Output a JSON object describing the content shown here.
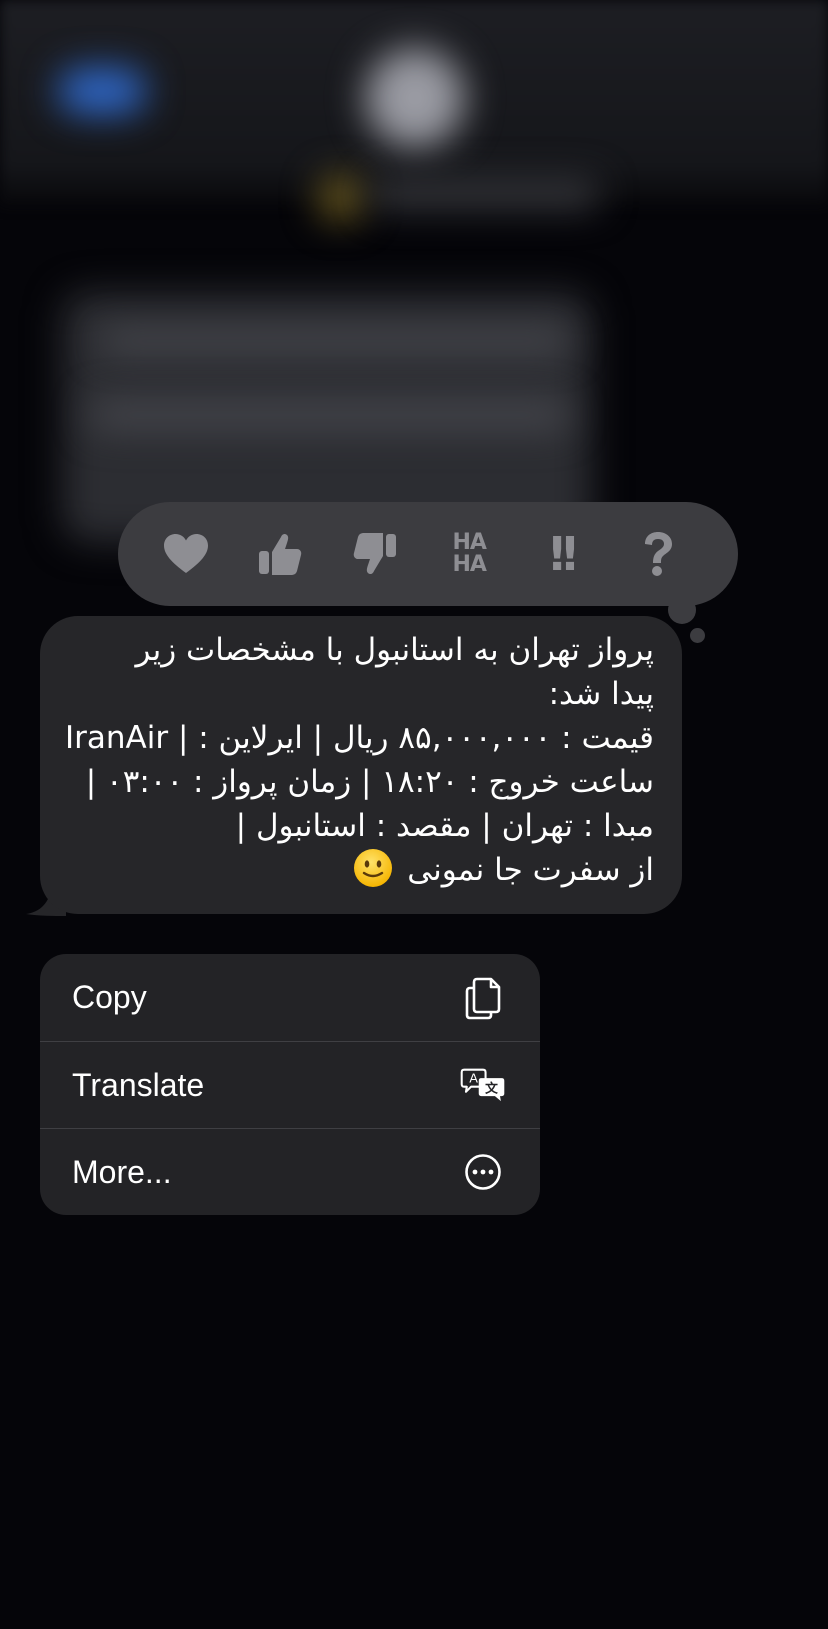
{
  "reactions": {
    "items": [
      "heart",
      "thumbs-up",
      "thumbs-down",
      "haha",
      "exclamation",
      "question"
    ],
    "haha_top": "HA",
    "haha_bottom": "HA",
    "emphasize_text": "!!",
    "question_text": "?"
  },
  "message": {
    "lines": [
      "پرواز تهران به استانبول با مشخصات زیر",
      "پیدا شد:",
      "قیمت : ۸۵,۰۰۰,۰۰۰ ریال | ایرلاین : IranAir |",
      "ساعت خروج : ۱۸:۲۰ | زمان پرواز : ۰۳:۰۰ |",
      "مبدا : تهران | مقصد : استانبول |",
      "از سفرت جا نمونی"
    ],
    "emoji": "slightly-smiling-face"
  },
  "menu": {
    "copy_label": "Copy",
    "copy_icon": "copy-icon",
    "translate_label": "Translate",
    "translate_icon": "translate-icon",
    "more_label": "More...",
    "more_icon": "ellipsis-circle-icon"
  },
  "colors": {
    "background": "#050509",
    "bubble": "#262629",
    "menu": "#232326",
    "tapback": "#3c3c40",
    "icon_gray": "#8e8e93"
  }
}
